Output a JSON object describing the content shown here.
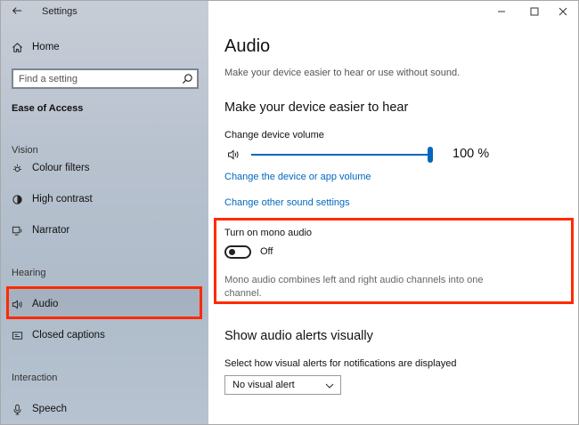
{
  "window": {
    "title": "Settings"
  },
  "sidebar": {
    "home_label": "Home",
    "search_placeholder": "Find a setting",
    "section_title": "Ease of Access",
    "groups": {
      "vision": "Vision",
      "hearing": "Hearing",
      "interaction": "Interaction"
    },
    "items": {
      "colour_filters": "Colour filters",
      "high_contrast": "High contrast",
      "narrator": "Narrator",
      "audio": "Audio",
      "closed_captions": "Closed captions",
      "speech": "Speech"
    },
    "selected": "Audio"
  },
  "main": {
    "title": "Audio",
    "subtitle": "Make your device easier to hear or use without sound.",
    "hear_heading": "Make your device easier to hear",
    "volume_label": "Change device volume",
    "volume_value": "100 %",
    "volume_level": 1.0,
    "link_device_app_volume": "Change the device or app volume",
    "link_sound_settings": "Change other sound settings",
    "mono_label": "Turn on mono audio",
    "mono_state": "Off",
    "mono_description": "Mono audio combines left and right audio channels into one channel.",
    "alerts_heading": "Show audio alerts visually",
    "alerts_label": "Select how visual alerts for notifications are displayed",
    "alerts_selected": "No visual alert"
  },
  "colors": {
    "accent": "#0067c0",
    "highlight": "#ff2a00"
  }
}
